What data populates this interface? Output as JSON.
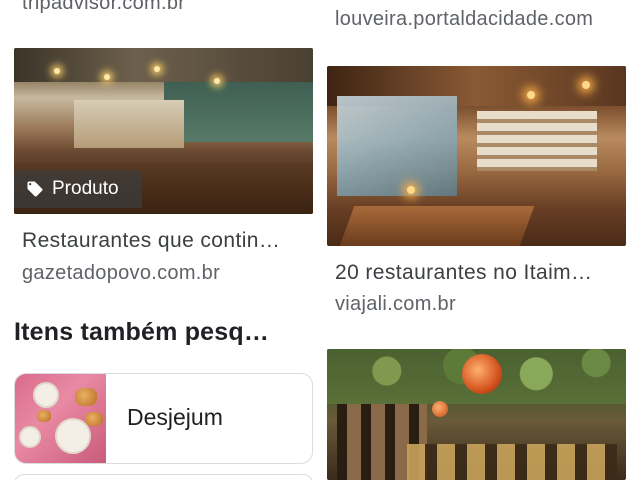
{
  "results": [
    {
      "source": "tripadvisor.com.br"
    },
    {
      "source": "louveira.portaldacidade.com"
    },
    {
      "title": "Restaurantes que contin…",
      "source": "gazetadopovo.com.br",
      "badge": "Produto",
      "badge_icon": "tag-icon"
    },
    {
      "title": "20 restaurantes no Itaim…",
      "source": "viajali.com.br"
    }
  ],
  "related": {
    "heading": "Itens também pesq…",
    "items": [
      {
        "label": "Desjejum",
        "thumb_icon": "breakfast-thumbnail"
      }
    ]
  },
  "colors": {
    "text_primary": "#202124",
    "text_secondary": "#5f6368",
    "card_border": "#dadce0",
    "badge_bg": "#3c3c3c"
  }
}
